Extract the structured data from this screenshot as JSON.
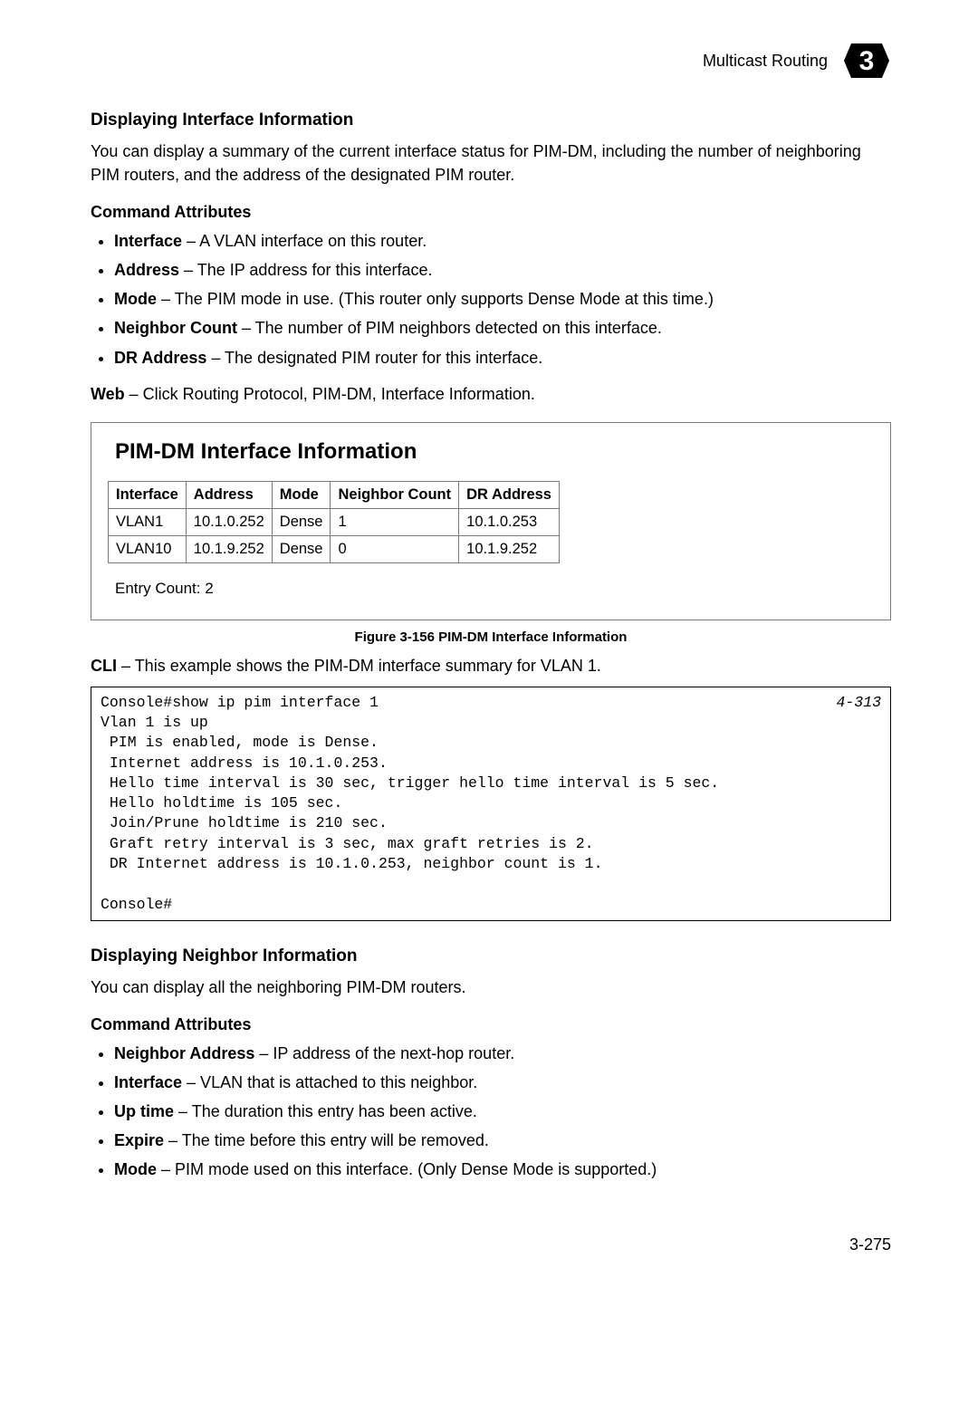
{
  "header": {
    "breadcrumb": "Multicast Routing",
    "chapter": "3"
  },
  "section1": {
    "title": "Displaying Interface Information",
    "intro": "You can display a summary of the current interface status for PIM-DM, including the number of neighboring PIM routers, and the address of the designated PIM router.",
    "attr_heading": "Command Attributes",
    "attrs": [
      {
        "name": "Interface",
        "desc": " – A VLAN interface on this router."
      },
      {
        "name": "Address",
        "desc": " – The IP address for this interface."
      },
      {
        "name": "Mode",
        "desc": " – The PIM mode in use. (This router only supports Dense Mode at this time.)"
      },
      {
        "name": "Neighbor Count",
        "desc": " – The number of PIM neighbors detected on this interface."
      },
      {
        "name": "DR Address",
        "desc": " – The designated PIM router for this interface."
      }
    ],
    "web_label": "Web",
    "web_text": " – Click Routing Protocol, PIM-DM, Interface Information."
  },
  "panel": {
    "title": "PIM-DM Interface Information",
    "headers": [
      "Interface",
      "Address",
      "Mode",
      "Neighbor Count",
      "DR Address"
    ],
    "rows": [
      [
        "VLAN1",
        "10.1.0.252",
        "Dense",
        "1",
        "10.1.0.253"
      ],
      [
        "VLAN10",
        "10.1.9.252",
        "Dense",
        "0",
        "10.1.9.252"
      ]
    ],
    "entry_count": "Entry Count: 2"
  },
  "figure_caption": "Figure 3-156   PIM-DM Interface Information",
  "cli": {
    "label": "CLI",
    "intro": " – This example shows the PIM-DM interface summary for VLAN 1.",
    "ref": "4-313",
    "text": "Console#show ip pim interface 1\nVlan 1 is up\n PIM is enabled, mode is Dense.\n Internet address is 10.1.0.253.\n Hello time interval is 30 sec, trigger hello time interval is 5 sec.\n Hello holdtime is 105 sec.\n Join/Prune holdtime is 210 sec.\n Graft retry interval is 3 sec, max graft retries is 2.\n DR Internet address is 10.1.0.253, neighbor count is 1.\n\nConsole#"
  },
  "section2": {
    "title": "Displaying Neighbor Information",
    "intro": "You can display all the neighboring PIM-DM routers.",
    "attr_heading": "Command Attributes",
    "attrs": [
      {
        "name": "Neighbor Address",
        "desc": " – IP address of the next-hop router."
      },
      {
        "name": "Interface",
        "desc": " – VLAN that is attached to this neighbor."
      },
      {
        "name": "Up time",
        "desc": " – The duration this entry has been active."
      },
      {
        "name": "Expire",
        "desc": " – The time before this entry will be removed."
      },
      {
        "name": "Mode",
        "desc": " – PIM mode used on this interface. (Only Dense Mode is supported.)"
      }
    ]
  },
  "page_number": "3-275"
}
